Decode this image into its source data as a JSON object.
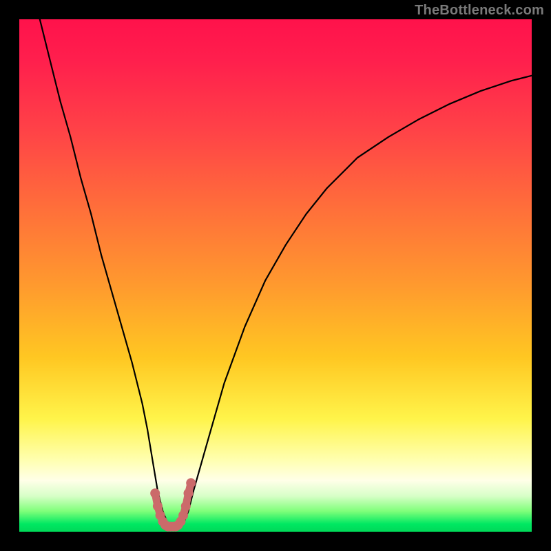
{
  "watermark": "TheBottleneck.com",
  "chart_data": {
    "type": "line",
    "title": "",
    "xlabel": "",
    "ylabel": "",
    "xlim": [
      0,
      100
    ],
    "ylim": [
      0,
      100
    ],
    "series": [
      {
        "name": "bottleneck-curve",
        "x": [
          4,
          6,
          8,
          10,
          12,
          14,
          16,
          18,
          20,
          22,
          24,
          25,
          26,
          27,
          28,
          29,
          30,
          31,
          32,
          33,
          34,
          36,
          38,
          40,
          44,
          48,
          52,
          56,
          60,
          66,
          72,
          78,
          84,
          90,
          96,
          100
        ],
        "y": [
          100,
          92,
          84,
          77,
          69,
          62,
          54,
          47,
          40,
          33,
          25,
          20,
          14,
          8,
          4,
          1.5,
          0.6,
          0.6,
          1.5,
          4,
          8,
          15,
          22,
          29,
          40,
          49,
          56,
          62,
          67,
          73,
          77,
          80.5,
          83.5,
          86,
          88,
          89
        ]
      },
      {
        "name": "marker-band",
        "x": [
          26.5,
          27.0,
          27.5,
          28.0,
          28.5,
          29.0,
          29.5,
          30.0,
          30.5,
          31.0,
          31.5,
          32.0,
          32.5,
          33.0,
          33.5
        ],
        "y": [
          7.5,
          5.0,
          3.2,
          2.0,
          1.3,
          1.0,
          1.0,
          1.0,
          1.0,
          1.3,
          2.0,
          3.2,
          5.0,
          7.5,
          9.5
        ]
      }
    ],
    "gradient_stops": [
      {
        "pos": 0.0,
        "color": "#ff124b"
      },
      {
        "pos": 0.22,
        "color": "#ff4347"
      },
      {
        "pos": 0.52,
        "color": "#ff9a2e"
      },
      {
        "pos": 0.78,
        "color": "#fff44a"
      },
      {
        "pos": 0.9,
        "color": "#ffffe8"
      },
      {
        "pos": 0.96,
        "color": "#7fff7a"
      },
      {
        "pos": 1.0,
        "color": "#00d858"
      }
    ],
    "marker_color": "#cb6a6a"
  }
}
